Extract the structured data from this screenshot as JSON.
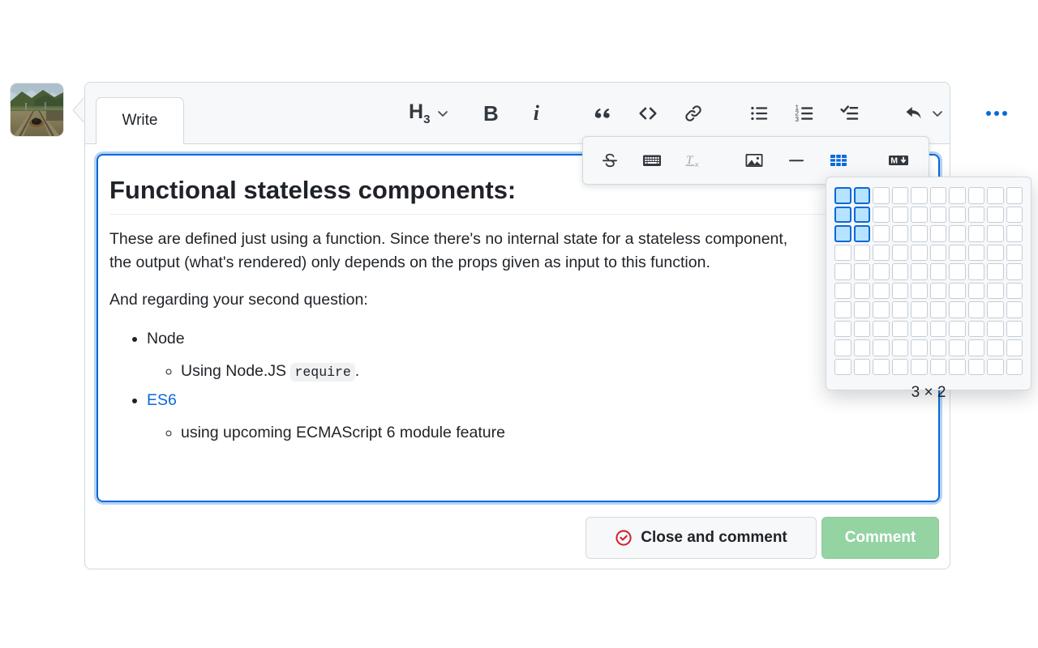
{
  "avatar": {
    "name": "user-avatar-railroad-photo"
  },
  "tabs": [
    {
      "id": "write",
      "label": "Write",
      "selected": true
    }
  ],
  "toolbar": {
    "heading": {
      "label": "H",
      "sub": "3",
      "name": "heading-level-button"
    },
    "bold_label": "B",
    "italic_label": "i",
    "quote_label": "“",
    "code_label": "<>",
    "link_name": "link-icon",
    "unordered_list_name": "unordered-list-icon",
    "ordered_list_name": "ordered-list-icon",
    "task_list_name": "task-list-icon",
    "reply_name": "reply-icon",
    "more_name": "more-options-icon",
    "more_active": true
  },
  "overflow_toolbar": {
    "visible": true,
    "strikethrough_label": "S",
    "keyboard_name": "keyboard-icon",
    "clear_formatting_label": "T",
    "clear_formatting_sub": "x",
    "clear_formatting_disabled": true,
    "image_name": "image-icon",
    "horizontal_rule_name": "horizontal-rule-icon",
    "table_name": "table-icon",
    "table_active": true,
    "markdown_label": "M",
    "markdown_name": "markdown-icon"
  },
  "table_picker": {
    "rows": 10,
    "cols": 10,
    "selected_rows": 3,
    "selected_cols": 2,
    "size_label": "3 × 2"
  },
  "editor": {
    "focused": true,
    "heading": "Functional stateless components:",
    "paragraph1_line1": "These are defined just using a function. Since there's no internal state for a stateless component,",
    "paragraph1_line2": "the output (what's rendered) only depends on the props given as input to this function.",
    "paragraph2": "And regarding your second question:",
    "list": [
      {
        "label": "Node",
        "link": false,
        "children": [
          {
            "prefix": "Using Node.JS ",
            "code": "require",
            "suffix": "."
          }
        ]
      },
      {
        "label": "ES6",
        "link": true,
        "children": [
          {
            "prefix": "using upcoming ECMAScript 6 module feature",
            "code": "",
            "suffix": ""
          }
        ]
      }
    ]
  },
  "footer": {
    "close_label": "Close and comment",
    "close_icon": "issue-closed-icon",
    "comment_label": "Comment",
    "comment_disabled": true
  },
  "colors": {
    "accent_blue": "#0969da",
    "selected_cell_fill": "#b6e3ff",
    "danger_red": "#cf222e",
    "comment_green_disabled": "#94d3a2",
    "toolbar_bg": "#f6f8fa",
    "border": "#d1d9e0",
    "text": "#1f2328"
  }
}
